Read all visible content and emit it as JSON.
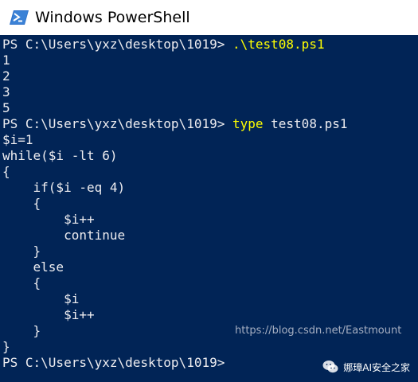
{
  "window": {
    "title": "Windows PowerShell",
    "icon": "powershell-icon"
  },
  "colors": {
    "console_bg": "#012456",
    "console_text": "#eeedf0",
    "command_highlight": "#ffff00"
  },
  "console": {
    "lines": [
      {
        "segments": [
          {
            "text": "PS C:\\Users\\yxz\\desktop\\1019> ",
            "style": "normal"
          },
          {
            "text": ".\\test08.ps1",
            "style": "cmd"
          }
        ]
      },
      {
        "segments": [
          {
            "text": "1",
            "style": "normal"
          }
        ]
      },
      {
        "segments": [
          {
            "text": "2",
            "style": "normal"
          }
        ]
      },
      {
        "segments": [
          {
            "text": "3",
            "style": "normal"
          }
        ]
      },
      {
        "segments": [
          {
            "text": "5",
            "style": "normal"
          }
        ]
      },
      {
        "segments": [
          {
            "text": "PS C:\\Users\\yxz\\desktop\\1019> ",
            "style": "normal"
          },
          {
            "text": "type",
            "style": "cmd"
          },
          {
            "text": " test08.ps1",
            "style": "normal"
          }
        ]
      },
      {
        "segments": [
          {
            "text": "$i=1",
            "style": "normal"
          }
        ]
      },
      {
        "segments": [
          {
            "text": "while($i -lt 6)",
            "style": "normal"
          }
        ]
      },
      {
        "segments": [
          {
            "text": "{",
            "style": "normal"
          }
        ]
      },
      {
        "segments": [
          {
            "text": "    if($i -eq 4)",
            "style": "normal"
          }
        ]
      },
      {
        "segments": [
          {
            "text": "    {",
            "style": "normal"
          }
        ]
      },
      {
        "segments": [
          {
            "text": "        $i++",
            "style": "normal"
          }
        ]
      },
      {
        "segments": [
          {
            "text": "        continue",
            "style": "normal"
          }
        ]
      },
      {
        "segments": [
          {
            "text": "    }",
            "style": "normal"
          }
        ]
      },
      {
        "segments": [
          {
            "text": "    else",
            "style": "normal"
          }
        ]
      },
      {
        "segments": [
          {
            "text": "    {",
            "style": "normal"
          }
        ]
      },
      {
        "segments": [
          {
            "text": "        $i",
            "style": "normal"
          }
        ]
      },
      {
        "segments": [
          {
            "text": "        $i++",
            "style": "normal"
          }
        ]
      },
      {
        "segments": [
          {
            "text": "    }",
            "style": "normal"
          }
        ]
      },
      {
        "segments": [
          {
            "text": "}",
            "style": "normal"
          }
        ]
      },
      {
        "segments": [
          {
            "text": "PS C:\\Users\\yxz\\desktop\\1019> ",
            "style": "normal"
          }
        ]
      }
    ]
  },
  "watermark": {
    "url": "https://blog.csdn.net/Eastmount",
    "label": "娜璋AI安全之家",
    "icon": "wechat-icon"
  }
}
